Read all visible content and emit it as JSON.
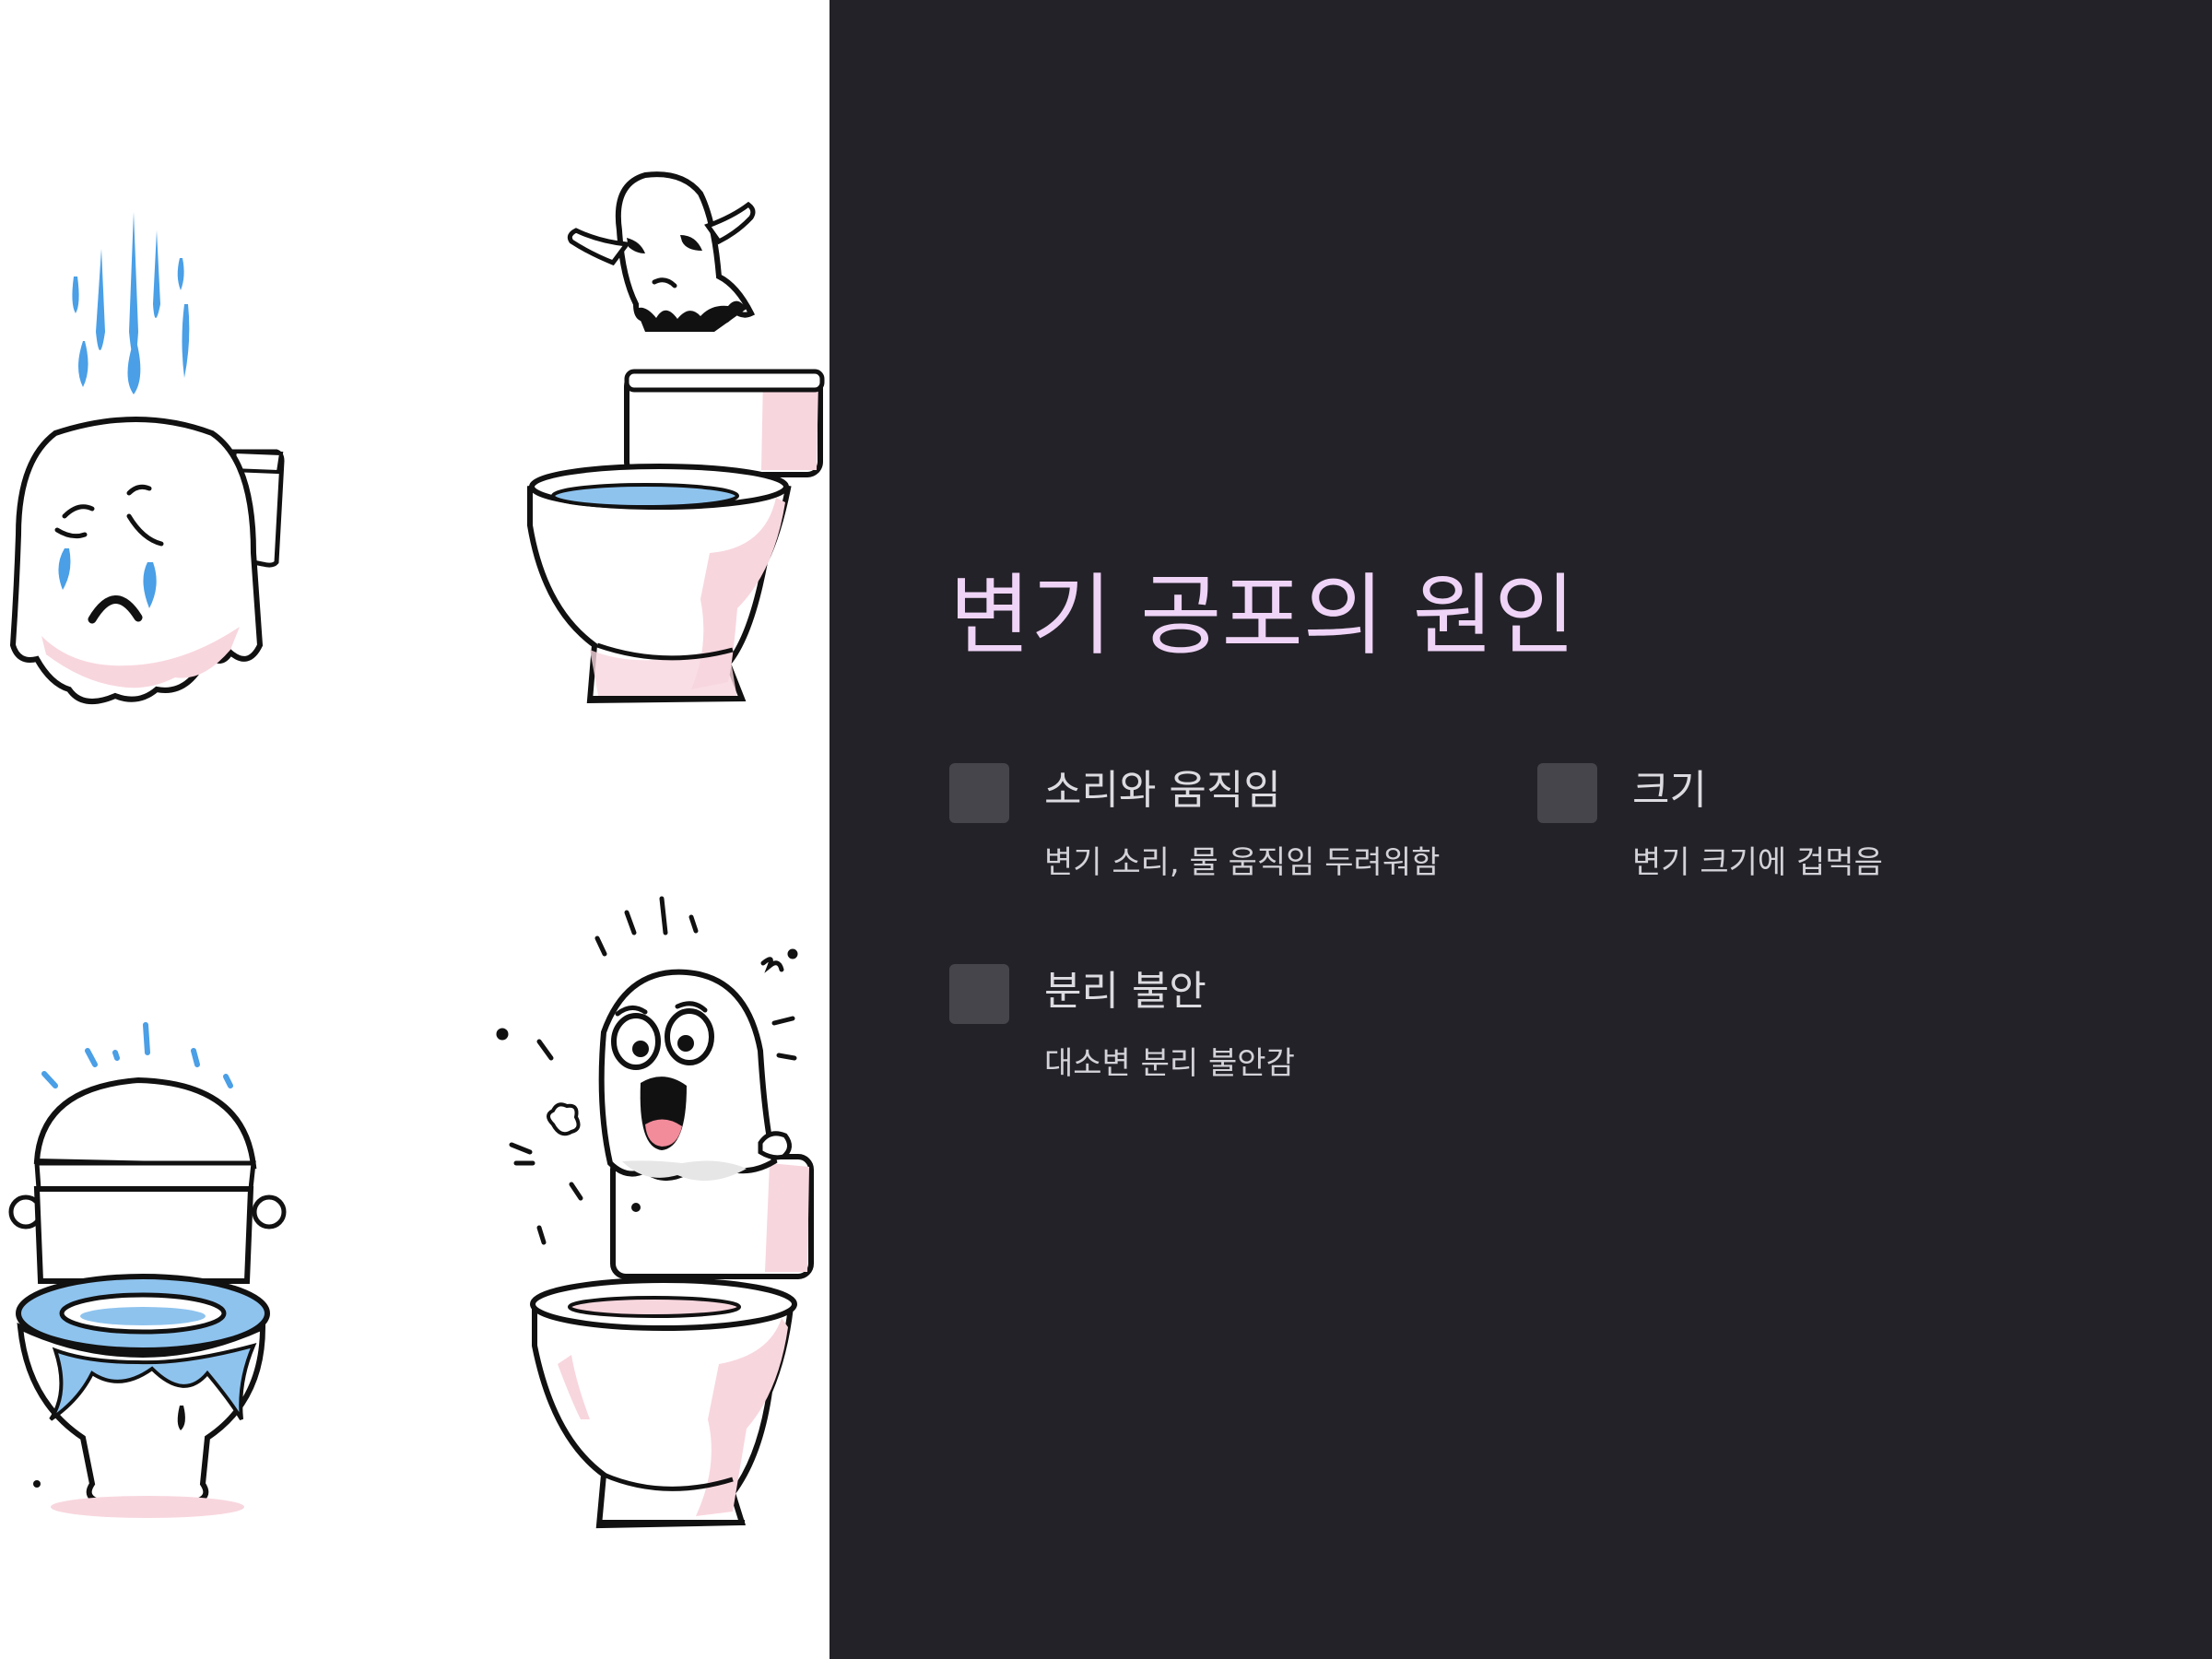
{
  "title": "변기 공포의 원인",
  "items": [
    {
      "heading": "소리와 움직임",
      "description": "변기 소리, 물 움직임 두려워함"
    },
    {
      "heading": "크기",
      "description": "변기 크기에 겁먹음"
    },
    {
      "heading": "분리 불안",
      "description": "대소변 분리 불안감"
    }
  ],
  "colors": {
    "background": "#232228",
    "title": "#efd4f7",
    "heading": "#dcdbe0",
    "description": "#d3d2d8",
    "icon_box": "#46454c",
    "illustration_panel": "#ffffff",
    "water": "#4a9fe6",
    "toilet_pink": "#f8d6de"
  },
  "illustrations": [
    "crying-melting-toilet-illustration",
    "ghost-over-toilet-illustration",
    "overflowing-toilet-illustration",
    "scared-ghost-in-toilet-illustration"
  ]
}
